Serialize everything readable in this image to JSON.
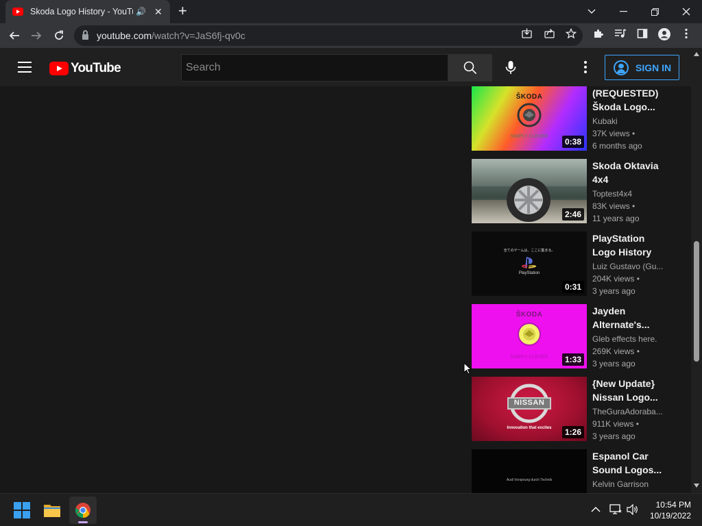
{
  "browser": {
    "tab_title": "Skoda Logo History - YouTube",
    "url_host": "youtube.com",
    "url_path": "/watch?v=JaS6fj-qv0c"
  },
  "youtube": {
    "logo_text": "YouTube",
    "search_placeholder": "Search",
    "sign_in_label": "SIGN IN"
  },
  "recommendations": [
    {
      "title": "(REQUESTED) Škoda Logo...",
      "channel": "Kubaki",
      "views": "37K views •",
      "age": "6 months ago",
      "duration": "0:38",
      "thumb_text": "ŠKODA",
      "thumb_sub": "SIMPLY CLEVER"
    },
    {
      "title": "Skoda Oktavia 4x4",
      "channel": "Toptest4x4",
      "views": "83K views •",
      "age": "11 years ago",
      "duration": "2:46"
    },
    {
      "title": "PlayStation Logo History",
      "channel": "Luiz Gustavo (Gu...",
      "views": "204K views •",
      "age": "3 years ago",
      "duration": "0:31",
      "thumb_text": "PlayStation",
      "thumb_jp": "全てのゲームは、ここに集まる。"
    },
    {
      "title": "Jayden Alternate's...",
      "channel": "Gleb effects here.",
      "views": "269K views •",
      "age": "3 years ago",
      "duration": "1:33",
      "thumb_text": "ŠKODA",
      "thumb_sub": "SIMPLY CLEVER"
    },
    {
      "title": "{New Update} Nissan Logo...",
      "channel": "TheGuraAdoraba...",
      "views": "911K views •",
      "age": "3 years ago",
      "duration": "1:26",
      "thumb_text": "NISSAN",
      "thumb_sub": "Innovation that excites"
    },
    {
      "title": "Espanol Car Sound Logos...",
      "channel": "Kelvin Garrison",
      "views": "",
      "age": "",
      "duration": "",
      "thumb_sub": "Audi Vorsprung durch Technik"
    }
  ],
  "taskbar": {
    "time": "10:54 PM",
    "date": "10/19/2022"
  },
  "colors": {
    "youtube_red": "#ff0000",
    "signin_blue": "#3ea6ff",
    "page_bg": "#181818",
    "header_bg": "#202020"
  }
}
